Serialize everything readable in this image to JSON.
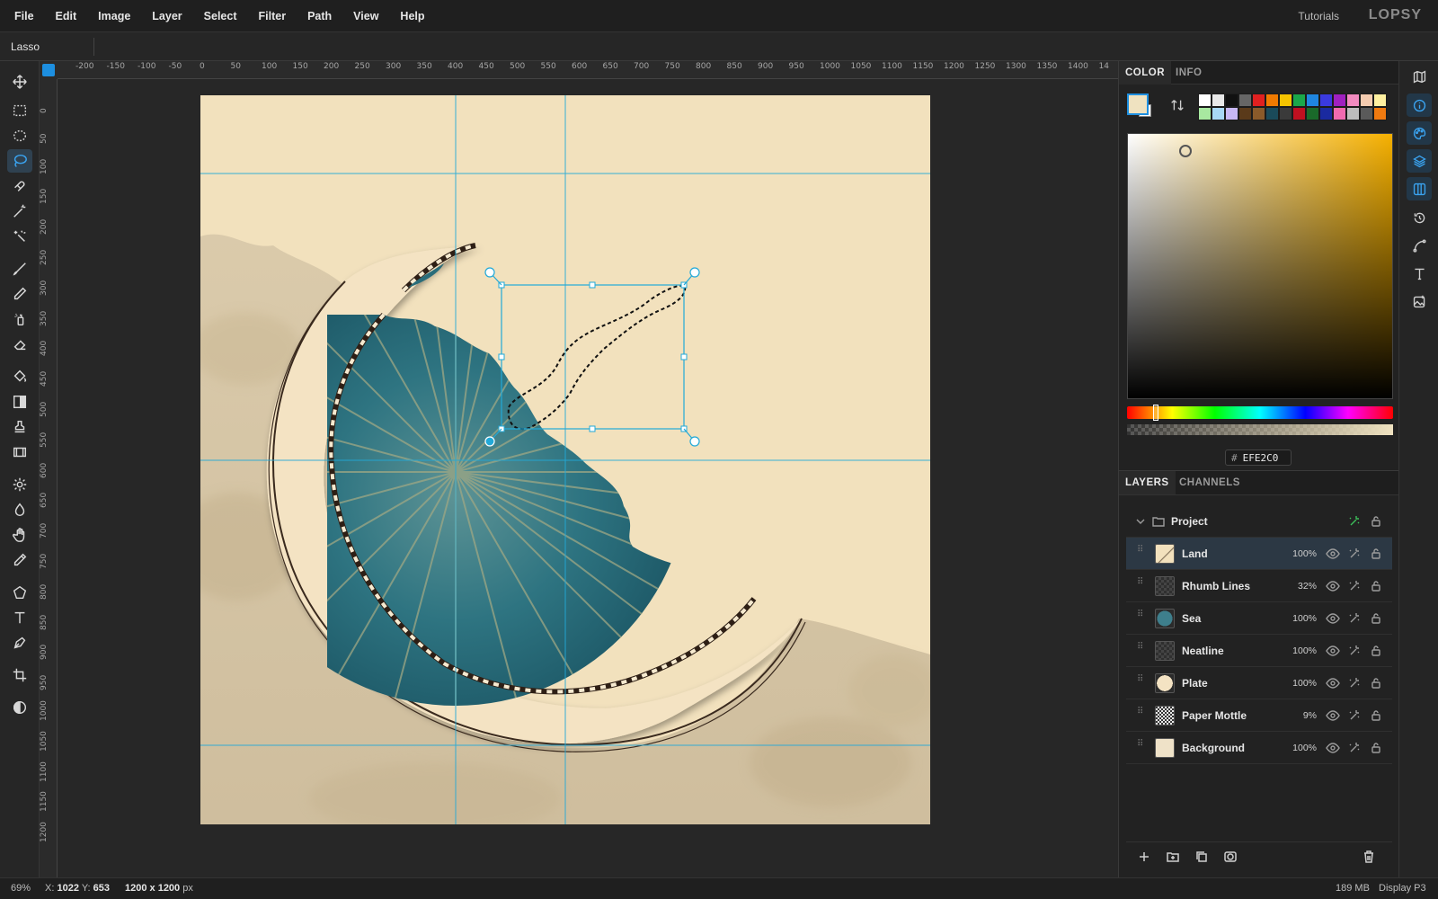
{
  "menu": [
    "File",
    "Edit",
    "Image",
    "Layer",
    "Select",
    "Filter",
    "Path",
    "View",
    "Help"
  ],
  "tutorials_label": "Tutorials",
  "logo_text": "LOPSY",
  "options": {
    "tool_name": "Lasso"
  },
  "ruler": {
    "top_labels": [
      "-200",
      "-150",
      "-100",
      "-50",
      "0",
      "50",
      "100",
      "150",
      "200",
      "250",
      "300",
      "350",
      "400",
      "450",
      "500",
      "550",
      "600",
      "650",
      "700",
      "750",
      "800",
      "850",
      "900",
      "950",
      "1000",
      "1050",
      "1100",
      "1150",
      "1200",
      "1250",
      "1300",
      "1350",
      "1400",
      "14"
    ],
    "left_labels": [
      "0",
      "50",
      "100",
      "150",
      "200",
      "250",
      "300",
      "350",
      "400",
      "450",
      "500",
      "550",
      "600",
      "650",
      "700",
      "750",
      "800",
      "850",
      "900",
      "950",
      "1000",
      "1050",
      "1100",
      "1150",
      "1200"
    ]
  },
  "panel": {
    "tabs": [
      "COLOR",
      "INFO"
    ],
    "hex_value": "EFE2C0",
    "foreground_color": "#EFE2C0",
    "palette": [
      "#ffffff",
      "#e8e8e8",
      "#111111",
      "#666666",
      "#e02020",
      "#f07a00",
      "#f5c400",
      "#1aa84a",
      "#1f86e0",
      "#3a3ae0",
      "#a020c0",
      "#f28bc0",
      "#f5ccb0",
      "#fff0a0",
      "#a8e8a0",
      "#a8d8f5",
      "#c8b8f5",
      "#5a3a1a",
      "#8a5a2a",
      "#1a4a5a",
      "#3a3a3a",
      "#c01020",
      "#1a6a2a",
      "#1a2aa0",
      "#f06ab0",
      "#bdbdbd",
      "#5a5a5a",
      "#f07a10"
    ],
    "layers_tabs": [
      "LAYERS",
      "CHANNELS"
    ],
    "layers": [
      {
        "name": "Project",
        "opacity": "",
        "kind": "folder"
      },
      {
        "name": "Land",
        "opacity": "100%",
        "kind": "land"
      },
      {
        "name": "Rhumb Lines",
        "opacity": "32%",
        "kind": "rhumb"
      },
      {
        "name": "Sea",
        "opacity": "100%",
        "kind": "sea"
      },
      {
        "name": "Neatline",
        "opacity": "100%",
        "kind": "empty"
      },
      {
        "name": "Plate",
        "opacity": "100%",
        "kind": "plate"
      },
      {
        "name": "Paper Mottle",
        "opacity": "9%",
        "kind": "mottle"
      },
      {
        "name": "Background",
        "opacity": "100%",
        "kind": "bg"
      }
    ],
    "selected_layer": "Land"
  },
  "status": {
    "zoom": "69%",
    "x_label": "X:",
    "x": "1022",
    "y_label": "Y:",
    "y": "653",
    "doc_size": "1200 x 1200",
    "doc_unit": "px",
    "memory": "189 MB",
    "color_profile": "Display P3"
  },
  "colors": {
    "accent": "#1e8fe0",
    "paper": "#EFE2C0",
    "sea": "#2d6e7c",
    "guide": "#22a9d8"
  }
}
